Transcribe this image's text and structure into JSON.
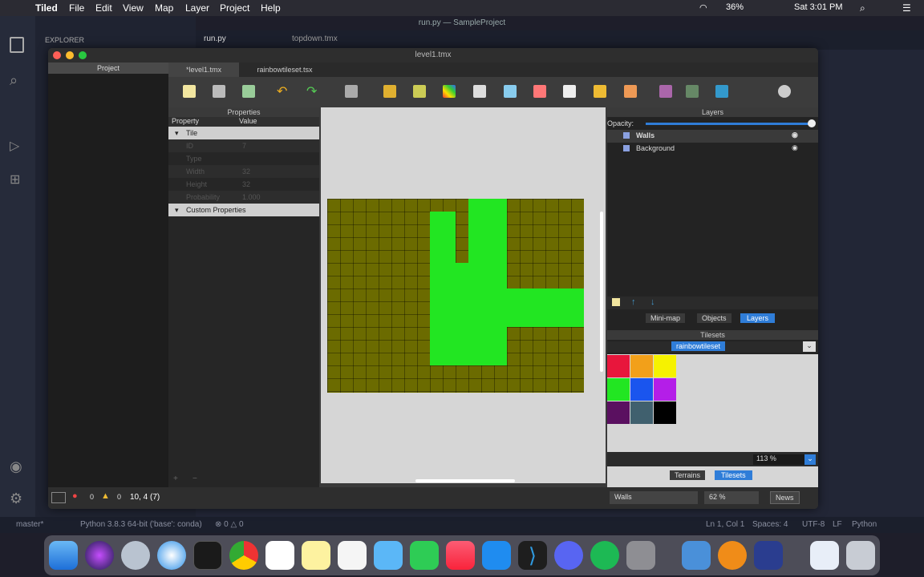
{
  "menubar": {
    "app": "Tiled",
    "items": [
      "File",
      "Edit",
      "View",
      "Map",
      "Layer",
      "Project",
      "Help"
    ],
    "battery": "36%",
    "clock": "Sat 3:01 PM"
  },
  "vscode": {
    "title": "run.py — SampleProject",
    "explorer": "EXPLORER",
    "tabs": [
      "run.py",
      "topdown.tmx"
    ],
    "status_branch": "master*",
    "status_python": "Python 3.8.3 64-bit ('base': conda)",
    "status_errors": "⊗ 0 △ 0",
    "status_right": [
      "Ln 1, Col 1",
      "Spaces: 4",
      "UTF-8",
      "LF",
      "Python"
    ]
  },
  "tiled": {
    "window_title": "level1.tmx",
    "project_label": "Project",
    "doc_tabs": [
      "*level1.tmx",
      "rainbowtileset.tsx"
    ],
    "properties": {
      "title": "Properties",
      "col_property": "Property",
      "col_value": "Value",
      "group_tile": "Tile",
      "rows": [
        {
          "k": "ID",
          "v": "7"
        },
        {
          "k": "Type",
          "v": ""
        },
        {
          "k": "Width",
          "v": "32"
        },
        {
          "k": "Height",
          "v": "32"
        },
        {
          "k": "Probability",
          "v": "1.000"
        }
      ],
      "group_custom": "Custom Properties"
    },
    "layers": {
      "title": "Layers",
      "opacity": "Opacity:",
      "opacity_value": 1.0,
      "items": [
        "Walls",
        "Background"
      ],
      "tabs": [
        "Mini-map",
        "Objects",
        "Layers"
      ],
      "active_tab": "Layers"
    },
    "tilesets": {
      "title": "Tilesets",
      "selected": "rainbowtileset",
      "zoom": "113 %",
      "tabs": [
        "Terrains",
        "Tilesets"
      ],
      "active_tab": "Tilesets",
      "colors": [
        "#e8163c",
        "#f2a01a",
        "#f6f200",
        "#22e622",
        "#1a55ee",
        "#b41ee8",
        "#5a1060",
        "#40606e",
        "#000000"
      ]
    },
    "status": {
      "errors": "0",
      "warnings": "0",
      "coords": "10, 4 (7)",
      "layer": "Walls",
      "zoom": "62 %",
      "news": "News"
    },
    "map_colors": {
      "background": "#6b6b00",
      "wall": "#22e622"
    }
  }
}
